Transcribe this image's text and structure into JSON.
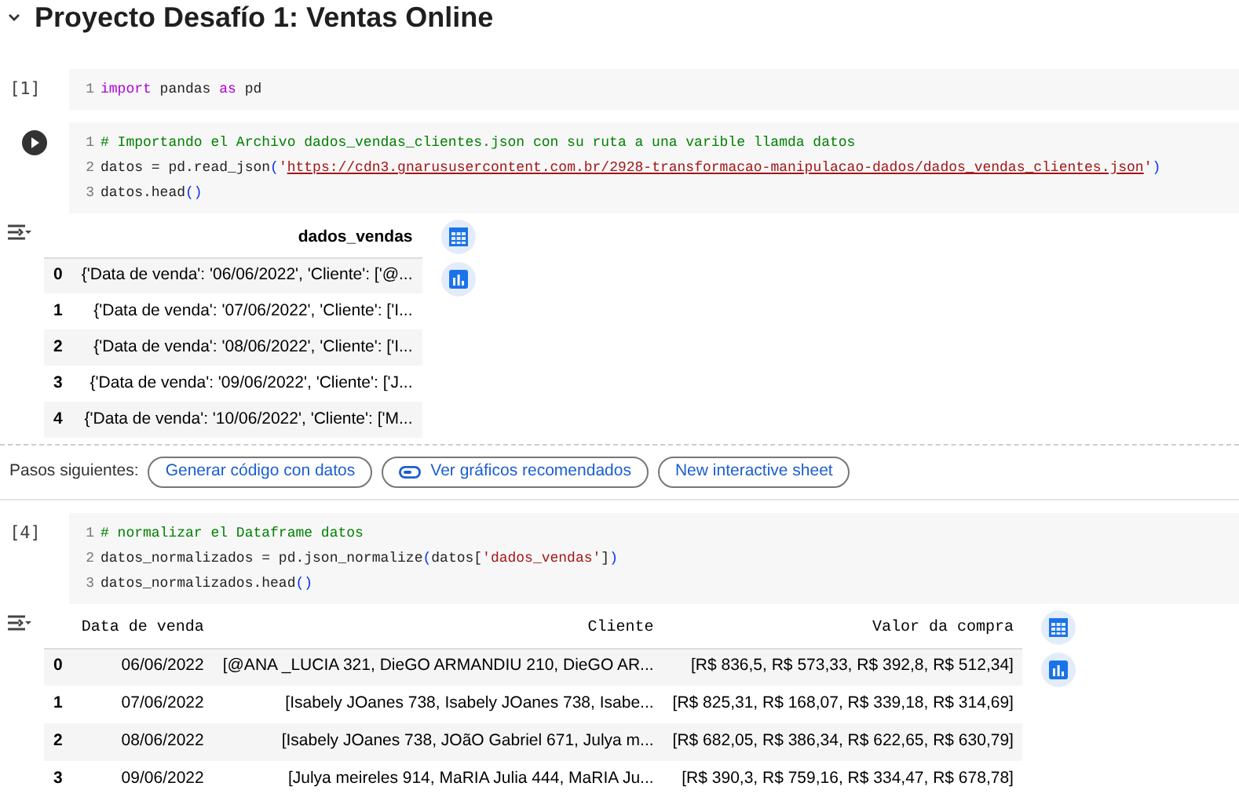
{
  "section": {
    "title": "Proyecto Desafío 1: Ventas Online",
    "expanded": true
  },
  "cells": [
    {
      "kind": "code",
      "exec": "[1]",
      "run_button": false,
      "lines": [
        {
          "number": "1",
          "tokens": [
            {
              "kind": "keyword",
              "text": "import"
            },
            {
              "kind": "plain",
              "text": " pandas "
            },
            {
              "kind": "keyword",
              "text": "as"
            },
            {
              "kind": "plain",
              "text": " pd"
            }
          ]
        }
      ]
    },
    {
      "kind": "code",
      "run_button": true,
      "lines": [
        {
          "number": "1",
          "tokens": [
            {
              "kind": "comment",
              "text": "# Importando el Archivo dados_vendas_clientes.json con su ruta a una varible llamda datos"
            }
          ]
        },
        {
          "number": "2",
          "tokens": [
            {
              "kind": "plain",
              "text": "datos = pd.read_json"
            },
            {
              "kind": "paren",
              "text": "("
            },
            {
              "kind": "string",
              "text": "'"
            },
            {
              "kind": "link",
              "text": "https://cdn3.gnarususercontent.com.br/2928-transformacao-manipulacao-dados/dados_vendas_clientes.json"
            },
            {
              "kind": "string",
              "text": "'"
            },
            {
              "kind": "paren",
              "text": ")"
            }
          ]
        },
        {
          "number": "3",
          "tokens": [
            {
              "kind": "plain",
              "text": "datos.head"
            },
            {
              "kind": "paren",
              "text": "()"
            }
          ]
        }
      ],
      "output": {
        "columns": [
          "",
          "dados_vendas"
        ],
        "rows": [
          [
            "0",
            "{'Data de venda': '06/06/2022', 'Cliente': ['@..."
          ],
          [
            "1",
            "{'Data de venda': '07/06/2022', 'Cliente': ['I..."
          ],
          [
            "2",
            "{'Data de venda': '08/06/2022', 'Cliente': ['I..."
          ],
          [
            "3",
            "{'Data de venda': '09/06/2022', 'Cliente': ['J..."
          ],
          [
            "4",
            "{'Data de venda': '10/06/2022', 'Cliente': ['M..."
          ]
        ],
        "next_steps": {
          "label": "Pasos siguientes:",
          "buttons": [
            {
              "label": "Generar código con datos",
              "icon": false
            },
            {
              "label": "Ver gráficos recomendados",
              "icon": true
            },
            {
              "label": "New interactive sheet",
              "icon": false
            }
          ]
        }
      }
    },
    {
      "kind": "code",
      "exec": "[4]",
      "run_button": false,
      "lines": [
        {
          "number": "1",
          "tokens": [
            {
              "kind": "comment",
              "text": "# normalizar el Dataframe datos"
            }
          ]
        },
        {
          "number": "2",
          "tokens": [
            {
              "kind": "plain",
              "text": "datos_normalizados = pd.json_normalize"
            },
            {
              "kind": "paren",
              "text": "("
            },
            {
              "kind": "plain",
              "text": "datos["
            },
            {
              "kind": "string",
              "text": "'dados_vendas'"
            },
            {
              "kind": "plain",
              "text": "]"
            },
            {
              "kind": "paren",
              "text": ")"
            }
          ]
        },
        {
          "number": "3",
          "tokens": [
            {
              "kind": "plain",
              "text": "datos_normalizados.head"
            },
            {
              "kind": "paren",
              "text": "()"
            }
          ]
        }
      ],
      "output": {
        "columns": [
          "",
          "Data de venda",
          "Cliente",
          "Valor da compra"
        ],
        "rows": [
          [
            "0",
            "06/06/2022",
            "[@ANA _LUCIA 321, DieGO ARMANDIU 210, DieGO AR...",
            "[R$ 836,5, R$ 573,33, R$ 392,8, R$ 512,34]"
          ],
          [
            "1",
            "07/06/2022",
            "[Isabely JOanes 738, Isabely JOanes 738, Isabe...",
            "[R$ 825,31, R$ 168,07, R$ 339,18, R$ 314,69]"
          ],
          [
            "2",
            "08/06/2022",
            "[Isabely JOanes 738, JOãO Gabriel 671, Julya m...",
            "[R$ 682,05, R$ 386,34, R$ 622,65, R$ 630,79]"
          ],
          [
            "3",
            "09/06/2022",
            "[Julya meireles 914, MaRIA Julia 444, MaRIA Ju...",
            "[R$ 390,3, R$ 759,16, R$ 334,47, R$ 678,78]"
          ]
        ]
      }
    }
  ]
}
